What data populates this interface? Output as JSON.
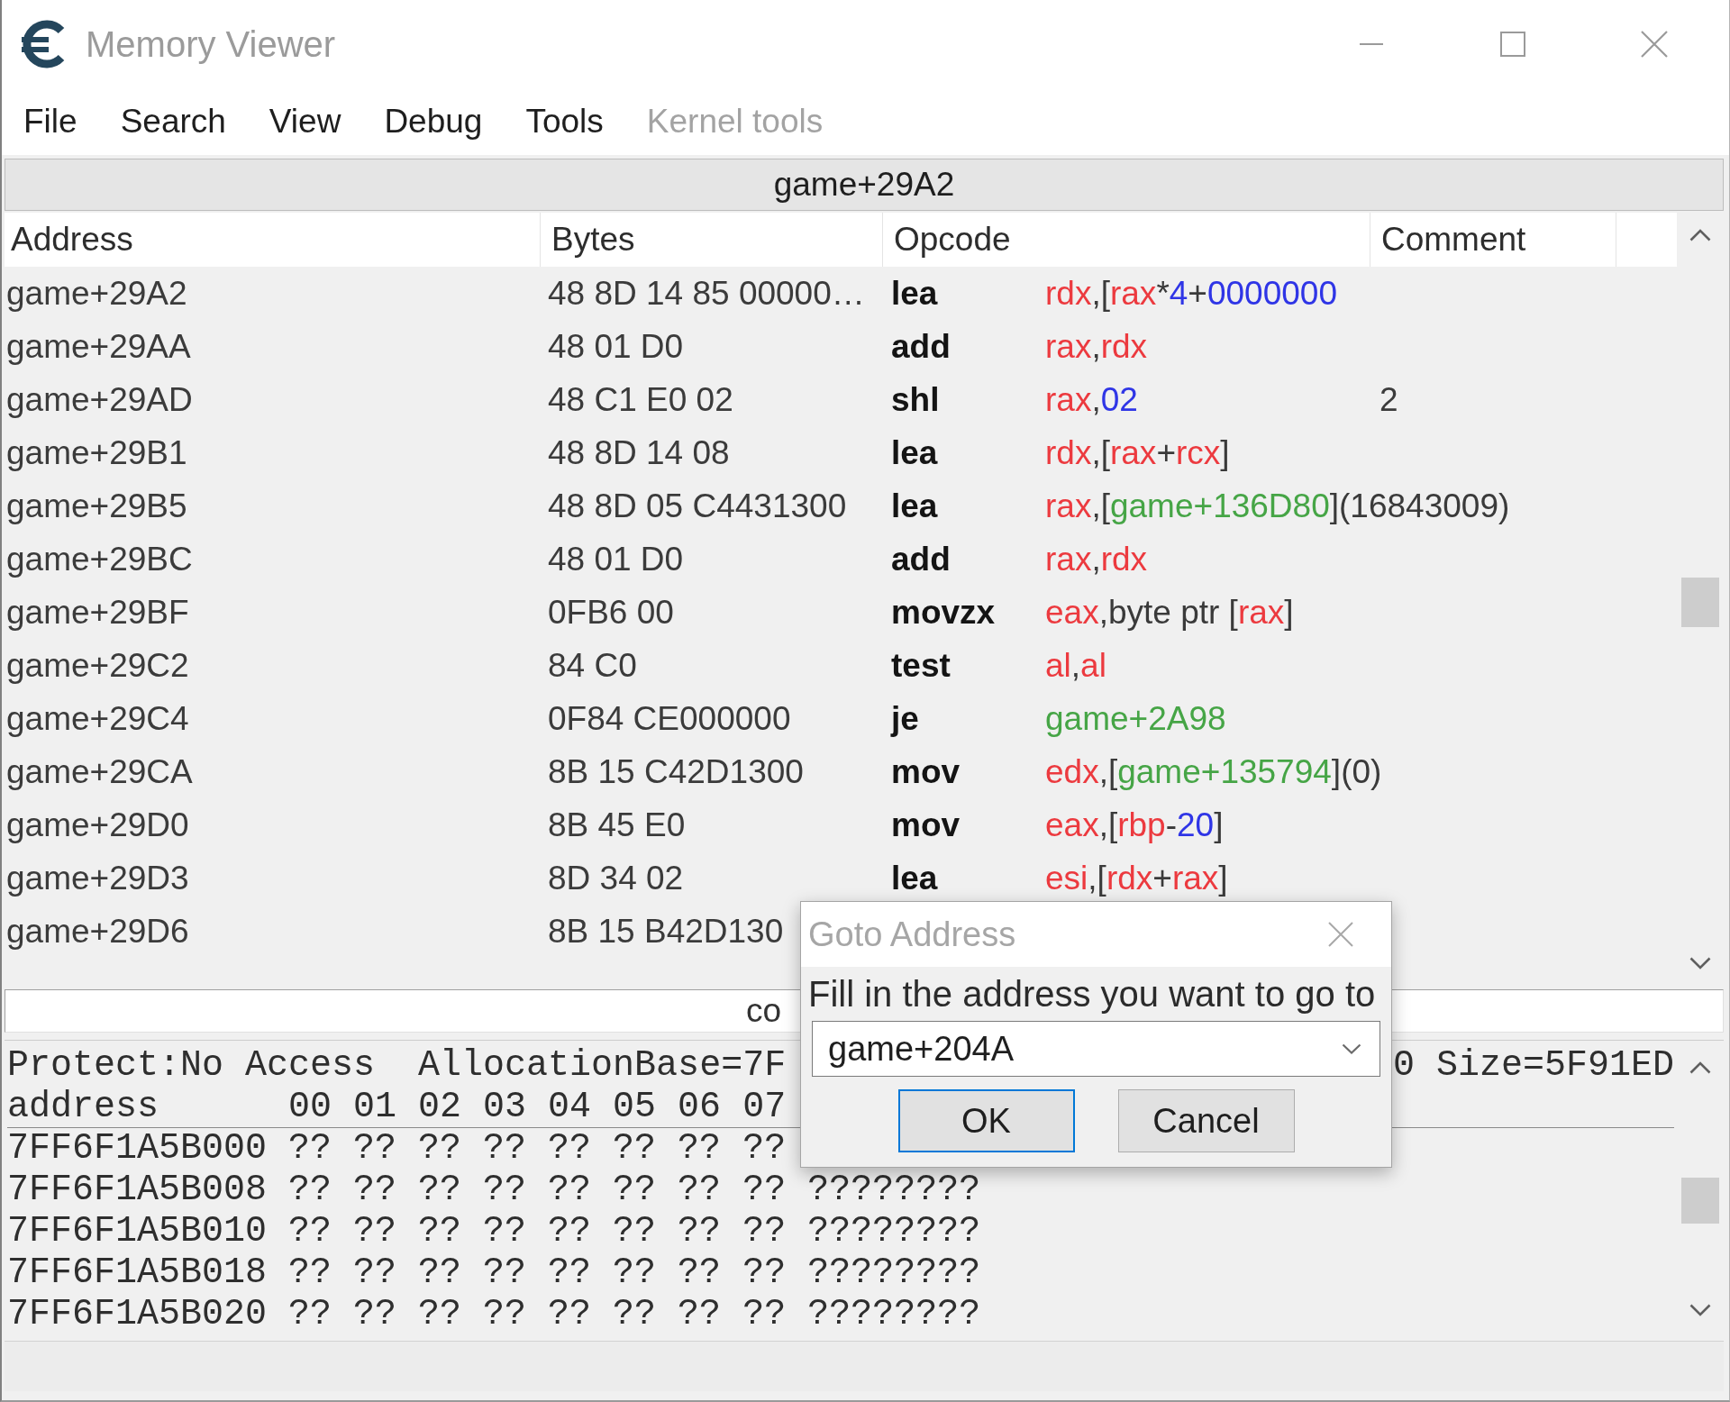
{
  "window": {
    "title": "Memory Viewer"
  },
  "menu": [
    {
      "label": "File",
      "disabled": false
    },
    {
      "label": "Search",
      "disabled": false
    },
    {
      "label": "View",
      "disabled": false
    },
    {
      "label": "Debug",
      "disabled": false
    },
    {
      "label": "Tools",
      "disabled": false
    },
    {
      "label": "Kernel tools",
      "disabled": true
    }
  ],
  "disassembler": {
    "current_address": "game+29A2",
    "columns": [
      "Address",
      "Bytes",
      "Opcode",
      "Comment"
    ],
    "rows": [
      {
        "address": "game+29A2",
        "bytes": "48 8D 14 85 00000…",
        "mnemonic": "lea",
        "operands": [
          {
            "kind": "reg",
            "text": "rdx"
          },
          {
            "kind": "text",
            "text": ",["
          },
          {
            "kind": "reg",
            "text": "rax"
          },
          {
            "kind": "text",
            "text": "*"
          },
          {
            "kind": "num",
            "text": "4"
          },
          {
            "kind": "text",
            "text": "+"
          },
          {
            "kind": "num",
            "text": "0000000"
          }
        ]
      },
      {
        "address": "game+29AA",
        "bytes": "48 01 D0",
        "mnemonic": "add",
        "operands": [
          {
            "kind": "reg",
            "text": "rax"
          },
          {
            "kind": "text",
            "text": ","
          },
          {
            "kind": "reg",
            "text": "rdx"
          }
        ]
      },
      {
        "address": "game+29AD",
        "bytes": "48 C1 E0 02",
        "mnemonic": "shl",
        "operands": [
          {
            "kind": "reg",
            "text": "rax"
          },
          {
            "kind": "text",
            "text": ","
          },
          {
            "kind": "num",
            "text": "02"
          }
        ],
        "comment": "2"
      },
      {
        "address": "game+29B1",
        "bytes": "48 8D 14 08",
        "mnemonic": "lea",
        "operands": [
          {
            "kind": "reg",
            "text": "rdx"
          },
          {
            "kind": "text",
            "text": ",["
          },
          {
            "kind": "reg",
            "text": "rax"
          },
          {
            "kind": "text",
            "text": "+"
          },
          {
            "kind": "reg",
            "text": "rcx"
          },
          {
            "kind": "text",
            "text": "]"
          }
        ]
      },
      {
        "address": "game+29B5",
        "bytes": "48 8D 05 C4431300",
        "mnemonic": "lea",
        "operands": [
          {
            "kind": "reg",
            "text": "rax"
          },
          {
            "kind": "text",
            "text": ",["
          },
          {
            "kind": "sym",
            "text": "game+136D80"
          },
          {
            "kind": "text",
            "text": "](16843009)"
          }
        ]
      },
      {
        "address": "game+29BC",
        "bytes": "48 01 D0",
        "mnemonic": "add",
        "operands": [
          {
            "kind": "reg",
            "text": "rax"
          },
          {
            "kind": "text",
            "text": ","
          },
          {
            "kind": "reg",
            "text": "rdx"
          }
        ]
      },
      {
        "address": "game+29BF",
        "bytes": "0FB6 00",
        "mnemonic": "movzx",
        "operands": [
          {
            "kind": "reg",
            "text": "eax"
          },
          {
            "kind": "text",
            "text": ",byte ptr ["
          },
          {
            "kind": "reg",
            "text": "rax"
          },
          {
            "kind": "text",
            "text": "]"
          }
        ]
      },
      {
        "address": "game+29C2",
        "bytes": "84 C0",
        "mnemonic": "test",
        "operands": [
          {
            "kind": "reg",
            "text": "al"
          },
          {
            "kind": "text",
            "text": ","
          },
          {
            "kind": "reg",
            "text": "al"
          }
        ]
      },
      {
        "address": "game+29C4",
        "bytes": "0F84 CE000000",
        "mnemonic": "je",
        "operands": [
          {
            "kind": "sym",
            "text": "game+2A98"
          }
        ]
      },
      {
        "address": "game+29CA",
        "bytes": "8B 15 C42D1300",
        "mnemonic": "mov",
        "operands": [
          {
            "kind": "reg",
            "text": "edx"
          },
          {
            "kind": "text",
            "text": ",["
          },
          {
            "kind": "sym",
            "text": "game+135794"
          },
          {
            "kind": "text",
            "text": "](0)"
          }
        ]
      },
      {
        "address": "game+29D0",
        "bytes": "8B 45 E0",
        "mnemonic": "mov",
        "operands": [
          {
            "kind": "reg",
            "text": "eax"
          },
          {
            "kind": "text",
            "text": ",["
          },
          {
            "kind": "reg",
            "text": "rbp"
          },
          {
            "kind": "text",
            "text": "-"
          },
          {
            "kind": "num",
            "text": "20"
          },
          {
            "kind": "text",
            "text": "]"
          }
        ]
      },
      {
        "address": "game+29D3",
        "bytes": "8D 34 02",
        "mnemonic": "lea",
        "operands": [
          {
            "kind": "reg",
            "text": "esi"
          },
          {
            "kind": "text",
            "text": ",["
          },
          {
            "kind": "reg",
            "text": "rdx"
          },
          {
            "kind": "text",
            "text": "+"
          },
          {
            "kind": "reg",
            "text": "rax"
          },
          {
            "kind": "text",
            "text": "]"
          }
        ]
      },
      {
        "address": "game+29D6",
        "bytes": "8B 15 B42D130"
      }
    ]
  },
  "info_bar": {
    "text": "co"
  },
  "hex_view": {
    "info": [
      "Protect:No Access  AllocationBase=7F",
      "0 Size=5F91ED"
    ],
    "header": {
      "label": "address",
      "columns": "00 01 02 03 04 05 06 07"
    },
    "rows": [
      {
        "address": "7FF6F1A5B000",
        "bytes": "?? ?? ?? ?? ?? ?? ?? ??"
      },
      {
        "address": "7FF6F1A5B008",
        "bytes": "?? ?? ?? ?? ?? ?? ?? ??",
        "ascii": "????????"
      },
      {
        "address": "7FF6F1A5B010",
        "bytes": "?? ?? ?? ?? ?? ?? ?? ??",
        "ascii": "????????"
      },
      {
        "address": "7FF6F1A5B018",
        "bytes": "?? ?? ?? ?? ?? ?? ?? ??",
        "ascii": "????????"
      },
      {
        "address": "7FF6F1A5B020",
        "bytes": "?? ?? ?? ?? ?? ?? ?? ??",
        "ascii": "????????"
      }
    ]
  },
  "dialog": {
    "title": "Goto Address",
    "prompt": "Fill in the address you want to go to",
    "value": "game+204A",
    "buttons": [
      {
        "label": "OK",
        "focused": true
      },
      {
        "label": "Cancel",
        "focused": false
      }
    ]
  }
}
